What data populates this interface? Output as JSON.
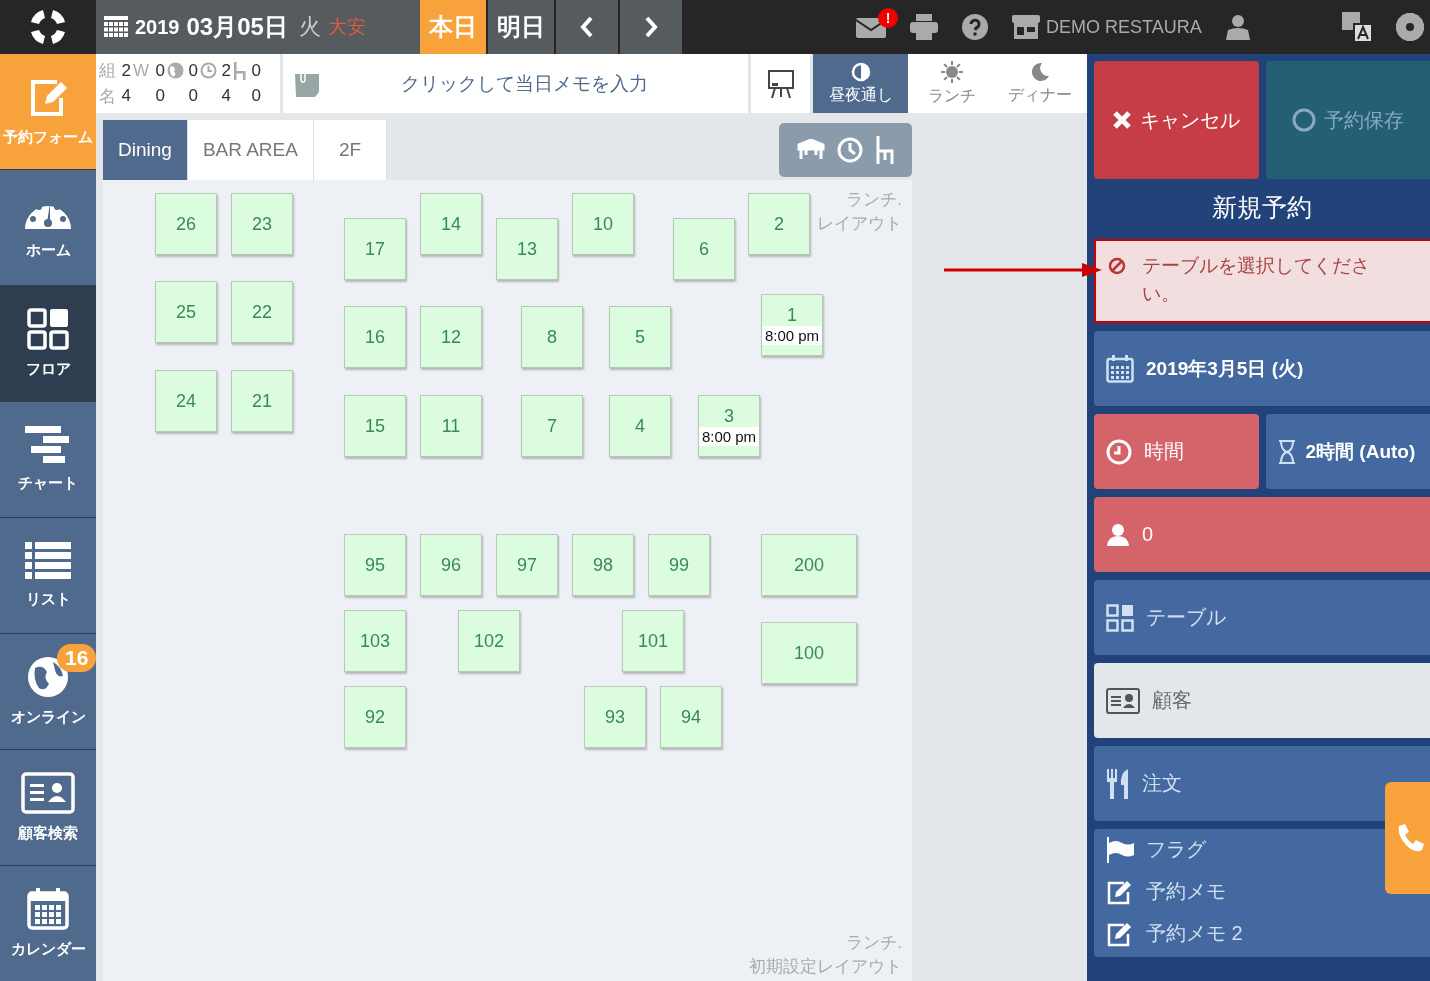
{
  "header": {
    "year": "2019",
    "date": "03月05日",
    "weekday": "火",
    "rokuyo": "大安",
    "today_button": "本日",
    "tomorrow_button": "明日",
    "mail_badge": "!",
    "store": "DEMO RESTAURA"
  },
  "sidebar": [
    {
      "label": "予約フォーム",
      "kind": "accent",
      "selected": false
    },
    {
      "label": "ホーム",
      "kind": "normal",
      "selected": false
    },
    {
      "label": "フロア",
      "kind": "normal",
      "selected": true
    },
    {
      "label": "チャート",
      "kind": "normal",
      "selected": false
    },
    {
      "label": "リスト",
      "kind": "normal",
      "selected": false
    },
    {
      "label": "オンライン",
      "kind": "normal",
      "selected": false,
      "badge": "16"
    },
    {
      "label": "顧客検索",
      "kind": "normal",
      "selected": false
    },
    {
      "label": "カレンダー",
      "kind": "normal",
      "selected": false
    }
  ],
  "stats": {
    "w_label": "W",
    "rows": [
      {
        "label": "組",
        "values": [
          "2",
          "0",
          "0",
          "2",
          "0"
        ]
      },
      {
        "label": "名",
        "values": [
          "4",
          "0",
          "0",
          "4",
          "0"
        ]
      }
    ]
  },
  "memo": {
    "text": "クリックして当日メモを入力"
  },
  "meal_filters": [
    {
      "label": "昼夜通し",
      "selected": true
    },
    {
      "label": "ランチ",
      "selected": false
    },
    {
      "label": "ディナー",
      "selected": false
    }
  ],
  "floor_tabs": [
    {
      "label": "Dining",
      "selected": true
    },
    {
      "label": "BAR AREA",
      "selected": false
    },
    {
      "label": "2F",
      "selected": false
    }
  ],
  "layout_captions": [
    {
      "lines": [
        "ランチ.",
        "レイアウト"
      ]
    },
    {
      "lines": [
        "ランチ.",
        "初期設定レイアウト"
      ]
    }
  ],
  "tables": [
    {
      "number": "26"
    },
    {
      "number": "23"
    },
    {
      "number": "17"
    },
    {
      "number": "14"
    },
    {
      "number": "13"
    },
    {
      "number": "10"
    },
    {
      "number": "6"
    },
    {
      "number": "2"
    },
    {
      "number": "25"
    },
    {
      "number": "22"
    },
    {
      "number": "16"
    },
    {
      "number": "12"
    },
    {
      "number": "8"
    },
    {
      "number": "5"
    },
    {
      "number": "1",
      "time": "8:00 pm"
    },
    {
      "number": "24"
    },
    {
      "number": "21"
    },
    {
      "number": "15"
    },
    {
      "number": "11"
    },
    {
      "number": "7"
    },
    {
      "number": "4"
    },
    {
      "number": "3",
      "time": "8:00 pm"
    },
    {
      "number": "95"
    },
    {
      "number": "96"
    },
    {
      "number": "97"
    },
    {
      "number": "98"
    },
    {
      "number": "99"
    },
    {
      "number": "200"
    },
    {
      "number": "103"
    },
    {
      "number": "102"
    },
    {
      "number": "101"
    },
    {
      "number": "100"
    },
    {
      "number": "92"
    },
    {
      "number": "93"
    },
    {
      "number": "94"
    }
  ],
  "panel": {
    "cancel": "キャンセル",
    "save": {
      "label": "予約保存",
      "disabled": true
    },
    "title": "新規予約",
    "alert": "テーブルを選択してください。",
    "date": "2019年3月5日 (火)",
    "time": {
      "label": "時間",
      "invalid": true
    },
    "duration": "2時間 (Auto)",
    "party": {
      "value": "0",
      "invalid": true
    },
    "rows": [
      {
        "label": "テーブル",
        "kind": "table",
        "muted": false
      },
      {
        "label": "顧客",
        "kind": "customer",
        "muted": true
      },
      {
        "label": "注文",
        "kind": "order",
        "muted": false
      }
    ],
    "extras": [
      {
        "label": "フラグ",
        "kind": "flag"
      },
      {
        "label": "予約メモ",
        "kind": "memo"
      },
      {
        "label": "予約メモ 2",
        "kind": "memo"
      }
    ]
  }
}
